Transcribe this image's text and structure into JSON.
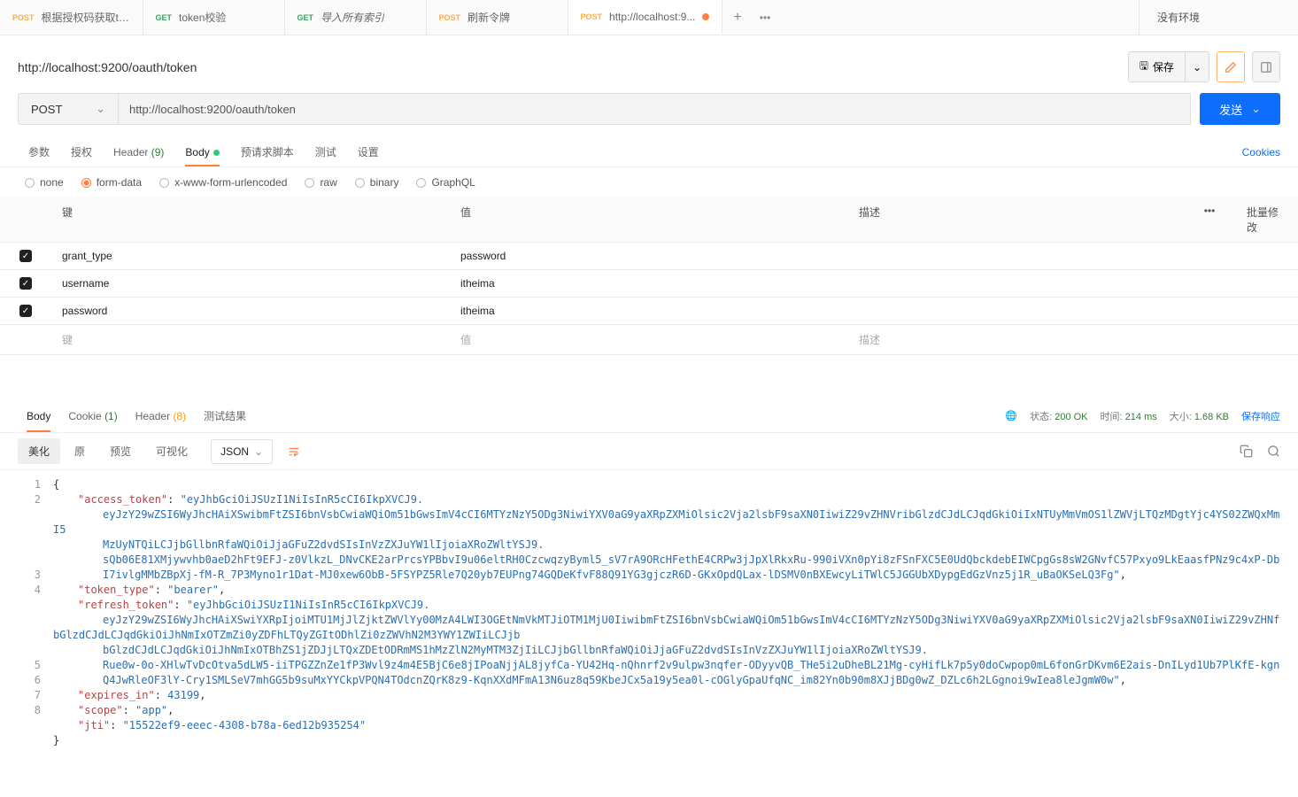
{
  "tabs": [
    {
      "method": "POST",
      "methodClass": "post",
      "label": "根据授权码获取to..."
    },
    {
      "method": "GET",
      "methodClass": "get",
      "label": "token校验"
    },
    {
      "method": "GET",
      "methodClass": "get",
      "label": "导入所有索引",
      "italic": true
    },
    {
      "method": "POST",
      "methodClass": "post",
      "label": "刷新令牌"
    },
    {
      "method": "POST",
      "methodClass": "post",
      "label": "http://localhost:9...",
      "dirty": true,
      "active": true
    }
  ],
  "envSelector": "没有环境",
  "pageTitle": "http://localhost:9200/oauth/token",
  "saveBtn": "保存",
  "method": "POST",
  "url": "http://localhost:9200/oauth/token",
  "sendBtn": "发送",
  "reqTabs": {
    "params": "参数",
    "auth": "授权",
    "headerLabel": "Header",
    "headerCount": "(9)",
    "body": "Body",
    "prereq": "预请求脚本",
    "tests": "测试",
    "settings": "设置",
    "cookies": "Cookies"
  },
  "bodyTypes": {
    "none": "none",
    "formdata": "form-data",
    "xwww": "x-www-form-urlencoded",
    "raw": "raw",
    "binary": "binary",
    "graphql": "GraphQL"
  },
  "kvHeaders": {
    "key": "键",
    "value": "值",
    "desc": "描述",
    "bulk": "批量修改"
  },
  "formRows": [
    {
      "key": "grant_type",
      "value": "password"
    },
    {
      "key": "username",
      "value": "itheima"
    },
    {
      "key": "password",
      "value": "itheima"
    }
  ],
  "placeholders": {
    "key": "键",
    "value": "值",
    "desc": "描述"
  },
  "respTabs": {
    "body": "Body",
    "cookieLabel": "Cookie",
    "cookieCount": "(1)",
    "headerLabel": "Header",
    "headerCount": "(8)",
    "results": "测试结果"
  },
  "respMeta": {
    "statusLabel": "状态:",
    "statusVal": "200 OK",
    "timeLabel": "时间:",
    "timeVal": "214 ms",
    "sizeLabel": "大小:",
    "sizeVal": "1.68 KB",
    "save": "保存响应"
  },
  "respToolbar": {
    "pretty": "美化",
    "raw": "原",
    "preview": "预览",
    "visual": "可视化",
    "format": "JSON"
  },
  "json": {
    "access_token_key": "\"access_token\"",
    "access_token_l1": "\"eyJhbGciOiJSUzI1NiIsInR5cCI6IkpXVCJ9.",
    "access_token_l2": "eyJzY29wZSI6WyJhcHAiXSwibmFtZSI6bnVsbCwiaWQiOm51bGwsImV4cCI6MTYzNzY5ODg3NiwiYXV0aG9yaXRpZXMiOlsic2Vja2lsbF9saXN0IiwiZ29vZHNVribGlzdCJdLCJqdGkiOiIxNTUyMmVmOS1lZWVjLTQzMDgtYjc4YS02ZWQxMmI5",
    "access_token_l3": "MzUyNTQiLCJjbGllbnRfaWQiOiJjaGFuZ2dvdSIsInVzZXJuYW1lIjoiaXRoZWltYSJ9.",
    "access_token_l4": "sQb06E81XMjywvhb0aeD2hFt9EFJ-z0VlkzL_DNvCKE2arPrcsYPBbvI9u06eltRH0CzcwqzyByml5_sV7rA9ORcHFethE4CRPw3jJpXlRkxRu-990iVXn0pYi8zFSnFXC5E0UdQbckdebEIWCpgGs8sW2GNvfC57Pxyo9LkEaasfPNz9c4xP-Db",
    "access_token_l5": "I7ivlgMMbZBpXj-fM-R_7P3Myno1r1Dat-MJ0xew6ObB-5FSYPZ5Rle7Q20yb7EUPng74GQDeKfvF88Q91YG3gjczR6D-GKxOpdQLax-lDSMV0nBXEwcyLiTWlC5JGGUbXDypgEdGzVnz5j1R_uBaOKSeLQ3Fg\"",
    "token_type_key": "\"token_type\"",
    "token_type_val": "\"bearer\"",
    "refresh_token_key": "\"refresh_token\"",
    "refresh_token_l1": "\"eyJhbGciOiJSUzI1NiIsInR5cCI6IkpXVCJ9.",
    "refresh_token_l2": "eyJzY29wZSI6WyJhcHAiXSwiYXRpIjoiMTU1MjJlZjktZWVlYy00MzA4LWI3OGEtNmVkMTJiOTM1MjU0IiwibmFtZSI6bnVsbCwiaWQiOm51bGwsImV4cCI6MTYzNzY5ODg3NiwiYXV0aG9yaXRpZXMiOlsic2Vja2lsbF9saXN0IiwiZ29vZHNfbGlzdCJdLCJqdGkiOiJhNmIxOTZmZi0yZDFhLTQyZGItODhlZi0zZWVhN2M3YWY1ZWIiLCJjb",
    "refresh_token_l3": "bGlzdCJdLCJqdGkiOiJhNmIxOTBhZS1jZDJjLTQxZDEtODRmMS1hMzZlN2MyMTM3ZjIiLCJjbGllbnRfaWQiOiJjaGFuZ2dvdSIsInVzZXJuYW1lIjoiaXRoZWltYSJ9.",
    "refresh_token_l4": "Rue0w-0o-XHlwTvDcOtva5dLW5-iiTPGZZnZe1fP3Wvl9z4m4E5BjC6e8jIPoaNjjAL8jyfCa-YU42Hq-nQhnrf2v9ulpw3nqfer-ODyyvQB_THe5i2uDheBL21Mg-cyHifLk7p5y0doCwpop0mL6fonGrDKvm6E2ais-DnILyd1Ub7PlKfE-kgn",
    "refresh_token_l5": "Q4JwRleOF3lY-Cry1SMLSeV7mhGG5b9suMxYYCkpVPQN4TOdcnZQrK8z9-KqnXXdMFmA13N6uz8q59KbeJCx5a19y5ea0l-cOGlyGpaUfqNC_im82Yn0b90m8XJjBDg0wZ_DZLc6h2LGgnoi9wIea8leJgmW0w\"",
    "expires_in_key": "\"expires_in\"",
    "expires_in_val": "43199",
    "scope_key": "\"scope\"",
    "scope_val": "\"app\"",
    "jti_key": "\"jti\"",
    "jti_val": "\"15522ef9-eeec-4308-b78a-6ed12b935254\""
  }
}
